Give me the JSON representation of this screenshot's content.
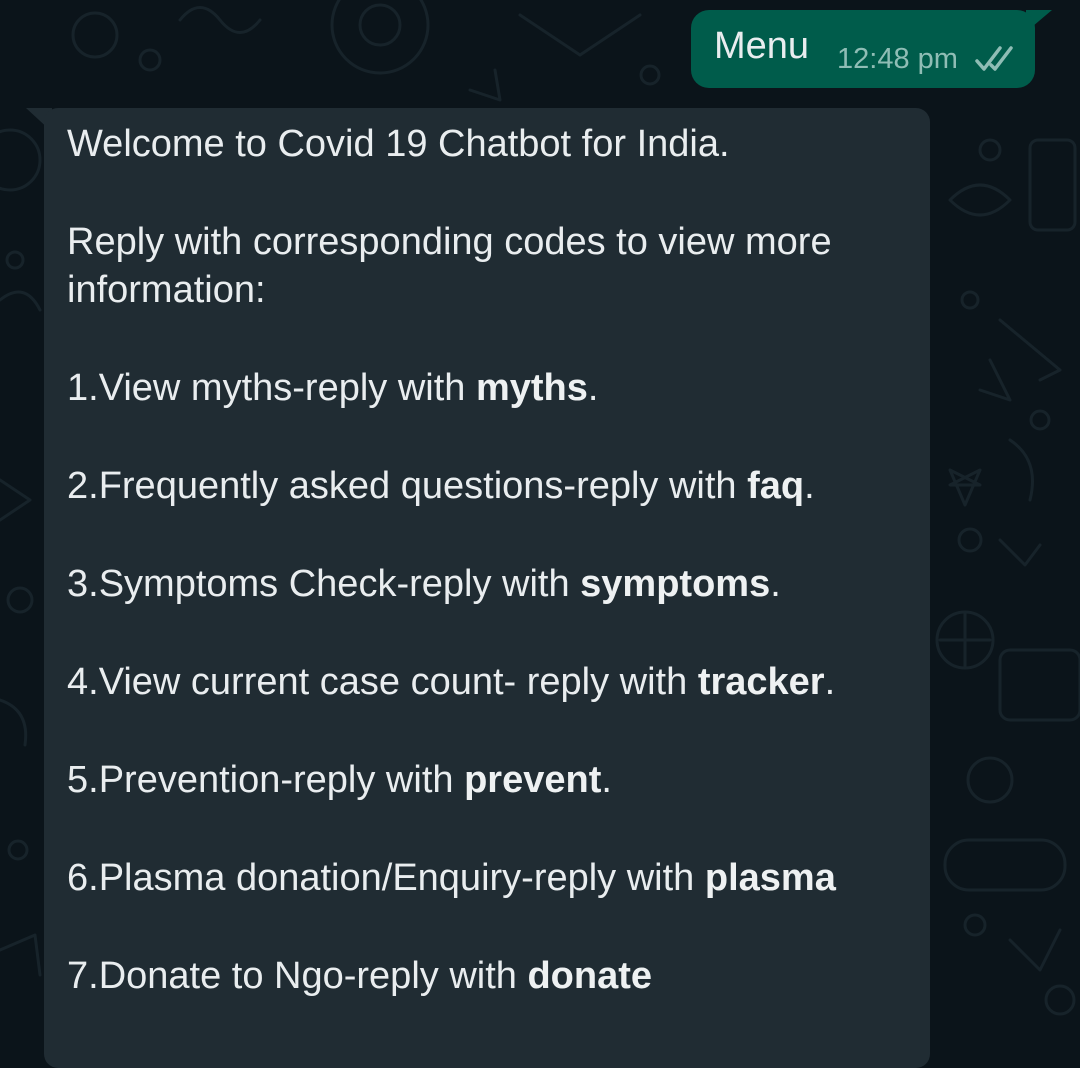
{
  "outgoing_message": {
    "text": "Menu",
    "time": "12:48 pm",
    "status_icon": "double-check-read-icon"
  },
  "incoming_message": {
    "welcome": "Welcome to Covid 19 Chatbot for India.",
    "instruction_line1": "Reply with corresponding codes to view more",
    "instruction_line2": "information:",
    "options": [
      {
        "prefix": "1.View myths-reply with ",
        "keyword": "myths",
        "suffix": "."
      },
      {
        "prefix": "2.Frequently asked questions-reply with ",
        "keyword": "faq",
        "suffix": "."
      },
      {
        "prefix": "3.Symptoms Check-reply with ",
        "keyword": "symptoms",
        "suffix": "."
      },
      {
        "prefix": "4.View current case count- reply with ",
        "keyword": "tracker",
        "suffix": "."
      },
      {
        "prefix": "5.Prevention-reply with ",
        "keyword": "prevent",
        "suffix": "."
      },
      {
        "prefix": "6.Plasma donation/Enquiry-reply with ",
        "keyword": "plasma",
        "suffix": ""
      },
      {
        "prefix": "7.Donate to Ngo-reply with ",
        "keyword": "donate",
        "suffix": ""
      }
    ]
  },
  "colors": {
    "chat_background": "#0b141a",
    "outgoing_bubble": "#005c4b",
    "incoming_bubble": "#202c33",
    "text": "#e9edef"
  }
}
